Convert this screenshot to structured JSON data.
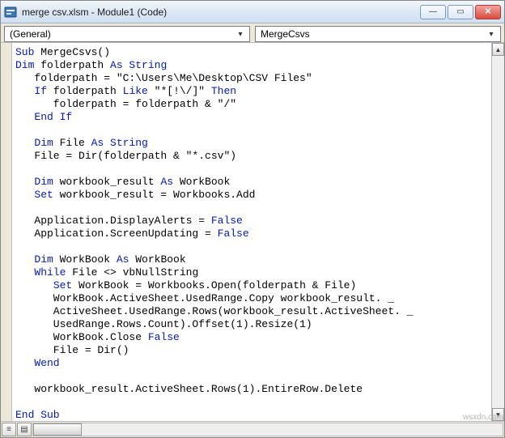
{
  "window": {
    "title": "merge csv.xlsm - Module1 (Code)"
  },
  "dropdowns": {
    "left": "(General)",
    "right": "MergeCsvs"
  },
  "code": {
    "tokens": [
      [
        [
          "kw",
          "Sub"
        ],
        [
          "",
          " MergeCsvs()"
        ]
      ],
      [
        [
          "kw",
          "Dim"
        ],
        [
          "",
          " folderpath "
        ],
        [
          "kw",
          "As String"
        ]
      ],
      [
        [
          "",
          "   folderpath = \"C:\\Users\\Me\\Desktop\\CSV Files\""
        ]
      ],
      [
        [
          "",
          "   "
        ],
        [
          "kw",
          "If"
        ],
        [
          "",
          " folderpath "
        ],
        [
          "kw",
          "Like"
        ],
        [
          "",
          " \"*[!\\/]\" "
        ],
        [
          "kw",
          "Then"
        ]
      ],
      [
        [
          "",
          "      folderpath = folderpath & \"/\""
        ]
      ],
      [
        [
          "",
          "   "
        ],
        [
          "kw",
          "End If"
        ]
      ],
      [
        [
          "",
          ""
        ]
      ],
      [
        [
          "",
          "   "
        ],
        [
          "kw",
          "Dim"
        ],
        [
          "",
          " File "
        ],
        [
          "kw",
          "As String"
        ]
      ],
      [
        [
          "",
          "   File = Dir(folderpath & \"*.csv\")"
        ]
      ],
      [
        [
          "",
          ""
        ]
      ],
      [
        [
          "",
          "   "
        ],
        [
          "kw",
          "Dim"
        ],
        [
          "",
          " workbook_result "
        ],
        [
          "kw",
          "As"
        ],
        [
          "",
          " WorkBook"
        ]
      ],
      [
        [
          "",
          "   "
        ],
        [
          "kw",
          "Set"
        ],
        [
          "",
          " workbook_result = Workbooks.Add"
        ]
      ],
      [
        [
          "",
          ""
        ]
      ],
      [
        [
          "",
          "   Application.DisplayAlerts = "
        ],
        [
          "kw",
          "False"
        ]
      ],
      [
        [
          "",
          "   Application.ScreenUpdating = "
        ],
        [
          "kw",
          "False"
        ]
      ],
      [
        [
          "",
          ""
        ]
      ],
      [
        [
          "",
          "   "
        ],
        [
          "kw",
          "Dim"
        ],
        [
          "",
          " WorkBook "
        ],
        [
          "kw",
          "As"
        ],
        [
          "",
          " WorkBook"
        ]
      ],
      [
        [
          "",
          "   "
        ],
        [
          "kw",
          "While"
        ],
        [
          "",
          " File <> vbNullString"
        ]
      ],
      [
        [
          "",
          "      "
        ],
        [
          "kw",
          "Set"
        ],
        [
          "",
          " WorkBook = Workbooks.Open(folderpath & File)"
        ]
      ],
      [
        [
          "",
          "      WorkBook.ActiveSheet.UsedRange.Copy workbook_result. _"
        ]
      ],
      [
        [
          "",
          "      ActiveSheet.UsedRange.Rows(workbook_result.ActiveSheet. _"
        ]
      ],
      [
        [
          "",
          "      UsedRange.Rows.Count).Offset(1).Resize(1)"
        ]
      ],
      [
        [
          "",
          "      WorkBook.Close "
        ],
        [
          "kw",
          "False"
        ]
      ],
      [
        [
          "",
          "      File = Dir()"
        ]
      ],
      [
        [
          "",
          "   "
        ],
        [
          "kw",
          "Wend"
        ]
      ],
      [
        [
          "",
          ""
        ]
      ],
      [
        [
          "",
          "   workbook_result.ActiveSheet.Rows(1).EntireRow.Delete"
        ]
      ],
      [
        [
          "",
          ""
        ]
      ],
      [
        [
          "kw",
          "End Sub"
        ]
      ]
    ]
  },
  "watermark": "wsxdn.com",
  "win_buttons": {
    "min": "—",
    "max": "▭",
    "close": "✕"
  }
}
